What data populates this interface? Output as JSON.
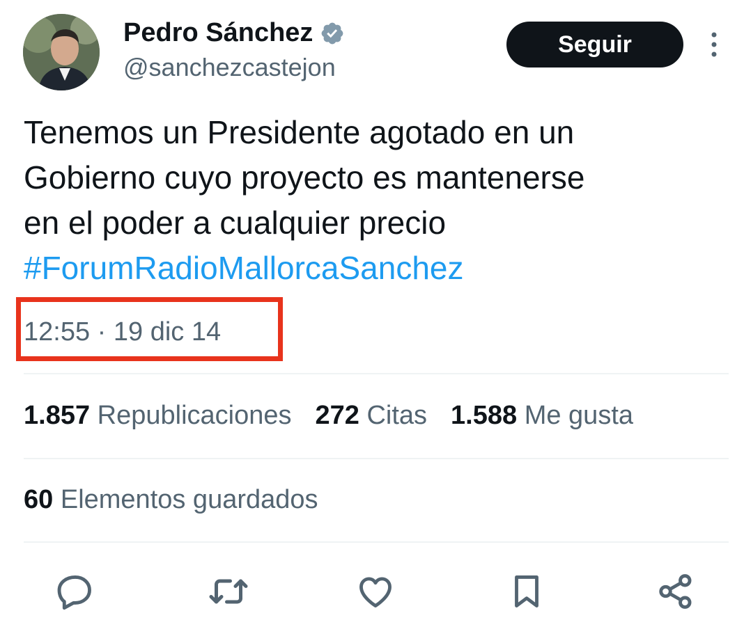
{
  "author": {
    "display_name": "Pedro Sánchez",
    "handle": "@sanchezcastejon",
    "verified_icon": "verified-badge-icon"
  },
  "header": {
    "follow_label": "Seguir"
  },
  "tweet": {
    "lines": [
      "Tenemos un Presidente agotado en un",
      "Gobierno cuyo proyecto es mantenerse",
      "en el poder a cualquier precio"
    ],
    "hashtag": "#ForumRadioMallorcaSanchez",
    "timestamp": "12:55 · 19 dic 14"
  },
  "stats": {
    "reposts_count": "1.857",
    "reposts_label": "Republicaciones",
    "quotes_count": "272",
    "quotes_label": "Citas",
    "likes_count": "1.588",
    "likes_label": "Me gusta",
    "bookmarks_count": "60",
    "bookmarks_label": "Elementos guardados"
  },
  "actions": [
    "reply-icon",
    "repost-icon",
    "like-icon",
    "bookmark-icon",
    "share-icon"
  ],
  "colors": {
    "text_primary": "#0f1419",
    "text_secondary": "#536471",
    "link": "#1d9bf0",
    "highlight_box": "#e8331c",
    "follow_button_bg": "#0f1419"
  }
}
